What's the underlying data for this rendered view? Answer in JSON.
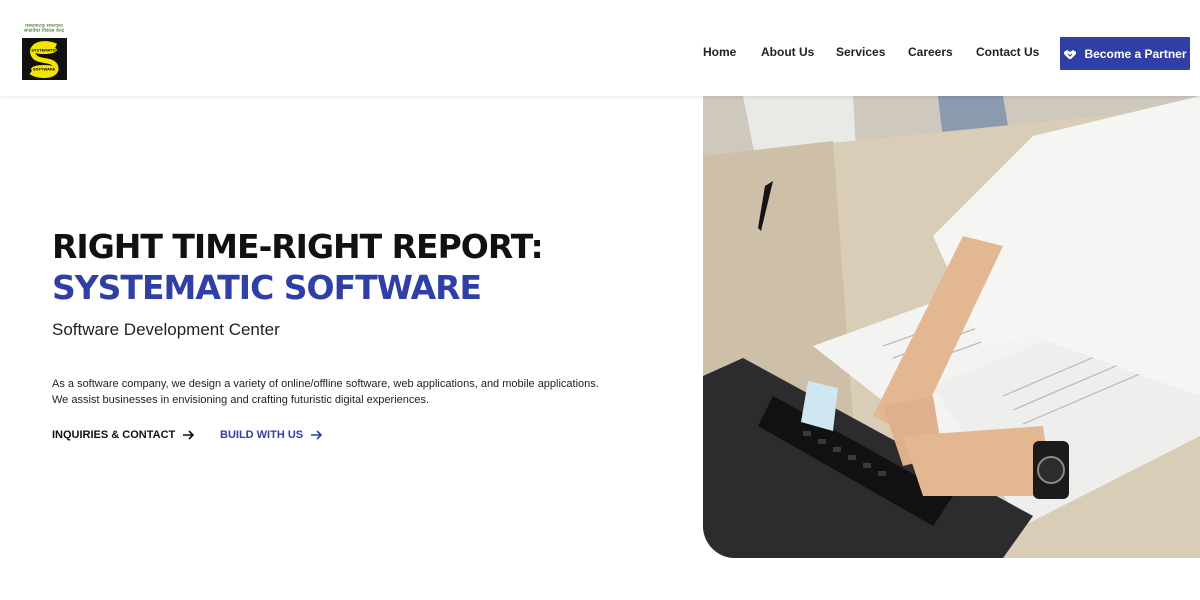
{
  "brand": {
    "logo_text_line1": "सिस्टमेटिक सफ्टवेयर",
    "logo_text_line2": "सफ्टवेयर विकास केन्द्र",
    "logo_mark_top": "SYSTEMATIC",
    "logo_mark_bottom": "SOFTWARE",
    "logo_colors": {
      "background": "#111111",
      "mark": "#f2e600"
    }
  },
  "nav": {
    "items": [
      {
        "label": "Home"
      },
      {
        "label": "About Us"
      },
      {
        "label": "Services"
      },
      {
        "label": "Careers"
      },
      {
        "label": "Contact Us"
      }
    ],
    "partner_button": {
      "label": "Become a Partner",
      "icon": "handshake-icon"
    }
  },
  "hero": {
    "title_line1": "RIGHT TIME-RIGHT REPORT:",
    "title_line2": "SYSTEMATIC SOFTWARE",
    "subtitle": "Software Development Center",
    "description": "As a software company, we design a variety of online/offline software, web applications, and mobile applications. We assist businesses in envisioning and crafting futuristic digital experiences.",
    "cta_primary": {
      "label": "INQUIRIES & CONTACT",
      "icon": "arrow-right-icon"
    },
    "cta_secondary": {
      "label": "BUILD WITH US",
      "icon": "arrow-right-icon"
    }
  },
  "colors": {
    "accent": "#2f3fa6",
    "text": "#111111"
  }
}
